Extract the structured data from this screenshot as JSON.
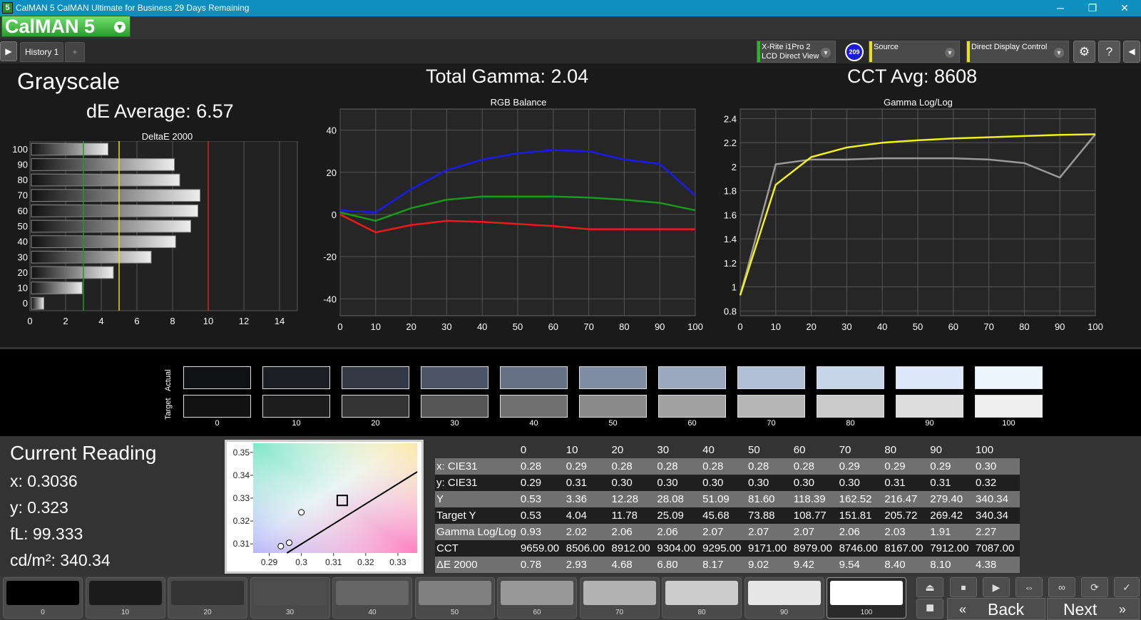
{
  "titlebar": {
    "icon": "5",
    "title": "CalMAN 5 CalMAN Ultimate for Business 29 Days Remaining",
    "minimize": "─",
    "restore": "❐",
    "close": "✕"
  },
  "logo": {
    "text": "CalMAN 5"
  },
  "tabs": {
    "history": "History 1",
    "add": "+"
  },
  "hardware": {
    "meter_line1": "X-Rite i1Pro 2",
    "meter_line2": "LCD Direct View",
    "meter_color": "#22bb22",
    "badge": "209",
    "source": "Source",
    "source_color": "#e8e020",
    "display": "Direct Display Control",
    "display_color": "#e8e020"
  },
  "headings": {
    "section": "Grayscale",
    "de_average": "dE Average: 6.57",
    "total_gamma": "Total Gamma: 2.04",
    "cct_avg": "CCT Avg: 8608"
  },
  "chart_data": [
    {
      "type": "bar",
      "title": "DeltaE 2000",
      "orientation": "horizontal",
      "categories": [
        "100",
        "90",
        "80",
        "70",
        "60",
        "50",
        "40",
        "30",
        "20",
        "10",
        "0"
      ],
      "values": [
        4.38,
        8.1,
        8.4,
        9.54,
        9.42,
        9.02,
        8.17,
        6.8,
        4.68,
        2.93,
        0.78
      ],
      "xlim": [
        0,
        15
      ],
      "xticks": [
        0,
        2,
        4,
        6,
        8,
        10,
        12,
        14
      ],
      "threshold_lines": [
        {
          "x": 3,
          "color": "#1aa01a"
        },
        {
          "x": 5,
          "color": "#e0e020"
        },
        {
          "x": 10,
          "color": "#e02020"
        }
      ]
    },
    {
      "type": "line",
      "title": "RGB Balance",
      "x": [
        0,
        10,
        20,
        30,
        40,
        50,
        60,
        70,
        80,
        90,
        100
      ],
      "series": [
        {
          "color": "#1a1aee",
          "values": [
            2,
            1,
            12,
            21,
            26,
            29,
            30.5,
            30,
            26,
            24,
            9
          ]
        },
        {
          "color": "#1a9a1a",
          "values": [
            1,
            -3,
            3,
            7,
            8.5,
            8.5,
            8.5,
            8,
            7,
            5.5,
            2
          ]
        },
        {
          "color": "#ee1a1a",
          "values": [
            0,
            -8.5,
            -5,
            -3,
            -3.5,
            -4.5,
            -5.5,
            -7,
            -7,
            -7,
            -7
          ]
        }
      ],
      "ylim": [
        -48,
        50
      ],
      "yticks": [
        40,
        20,
        0,
        -20,
        -40
      ],
      "xticks": [
        0,
        10,
        20,
        30,
        40,
        50,
        60,
        70,
        80,
        90,
        100
      ]
    },
    {
      "type": "line",
      "title": "Gamma Log/Log",
      "x": [
        0,
        10,
        20,
        30,
        40,
        50,
        60,
        70,
        80,
        90,
        100
      ],
      "series": [
        {
          "color": "#9a9a9a",
          "values": [
            0.93,
            2.02,
            2.06,
            2.06,
            2.07,
            2.07,
            2.07,
            2.06,
            2.03,
            1.91,
            2.27
          ]
        },
        {
          "color": "#f0f020",
          "values": [
            0.93,
            1.85,
            2.08,
            2.16,
            2.2,
            2.22,
            2.235,
            2.245,
            2.255,
            2.265,
            2.27
          ]
        }
      ],
      "ylim": [
        0.76,
        2.48
      ],
      "yticks": [
        2.4,
        2.2,
        2,
        1.8,
        1.6,
        1.4,
        1.2,
        1,
        0.8
      ],
      "xticks": [
        0,
        10,
        20,
        30,
        40,
        50,
        60,
        70,
        80,
        90,
        100
      ]
    },
    {
      "type": "scatter",
      "title": "CIE",
      "xlim": [
        0.285,
        0.336
      ],
      "ylim": [
        0.306,
        0.354
      ],
      "xticks": [
        0.29,
        0.3,
        0.31,
        0.32,
        0.33
      ],
      "yticks": [
        0.35,
        0.34,
        0.33,
        0.32,
        0.31
      ],
      "points": [
        [
          0.2936,
          0.309
        ],
        [
          0.2962,
          0.3105
        ],
        [
          0.3,
          0.3238
        ]
      ],
      "target": [
        0.3127,
        0.329
      ]
    }
  ],
  "swatches": {
    "row_labels": {
      "actual": "Actual",
      "target": "Target"
    },
    "labels": [
      "0",
      "10",
      "20",
      "30",
      "40",
      "50",
      "60",
      "70",
      "80",
      "90",
      "100"
    ],
    "actual": [
      "#101114",
      "#1b1f25",
      "#323944",
      "#4c5566",
      "#667185",
      "#808da4",
      "#9aa8c0",
      "#b0bfd6",
      "#c6d5ea",
      "#dde9fb",
      "#edf5fe"
    ],
    "target": [
      "#121212",
      "#1d1d1d",
      "#333333",
      "#555555",
      "#707070",
      "#8a8a8a",
      "#a1a1a1",
      "#b6b6b6",
      "#cacaca",
      "#dcdcdc",
      "#efefef"
    ]
  },
  "current_reading": {
    "title": "Current Reading",
    "x": "x: 0.3036",
    "y": "y: 0.323",
    "fl": "fL: 99.333",
    "cdm2": "cd/m²: 340.34"
  },
  "table": {
    "header": [
      "",
      "0",
      "10",
      "20",
      "30",
      "40",
      "50",
      "60",
      "70",
      "80",
      "90",
      "100"
    ],
    "rows": [
      {
        "label": "x: CIE31",
        "values": [
          "0.28",
          "0.29",
          "0.28",
          "0.28",
          "0.28",
          "0.28",
          "0.28",
          "0.29",
          "0.29",
          "0.29",
          "0.30"
        ]
      },
      {
        "label": "y: CIE31",
        "values": [
          "0.29",
          "0.31",
          "0.30",
          "0.30",
          "0.30",
          "0.30",
          "0.30",
          "0.30",
          "0.31",
          "0.31",
          "0.32"
        ]
      },
      {
        "label": "Y",
        "values": [
          "0.53",
          "3.36",
          "12.28",
          "28.08",
          "51.09",
          "81.60",
          "118.39",
          "162.52",
          "216.47",
          "279.40",
          "340.34"
        ]
      },
      {
        "label": "Target Y",
        "values": [
          "0.53",
          "4.04",
          "11.78",
          "25.09",
          "45.68",
          "73.88",
          "108.77",
          "151.81",
          "205.72",
          "269.42",
          "340.34"
        ]
      },
      {
        "label": "Gamma Log/Log",
        "values": [
          "0.93",
          "2.02",
          "2.06",
          "2.06",
          "2.07",
          "2.07",
          "2.07",
          "2.06",
          "2.03",
          "1.91",
          "2.27"
        ]
      },
      {
        "label": "CCT",
        "values": [
          "9659.00",
          "8506.00",
          "8912.00",
          "9304.00",
          "9295.00",
          "9171.00",
          "8979.00",
          "8746.00",
          "8167.00",
          "7912.00",
          "7087.00"
        ]
      },
      {
        "label": "ΔE 2000",
        "values": [
          "0.78",
          "2.93",
          "4.68",
          "6.80",
          "8.17",
          "9.02",
          "9.42",
          "9.54",
          "8.40",
          "8.10",
          "4.38"
        ]
      }
    ]
  },
  "footer": {
    "swatch_labels": [
      "0",
      "10",
      "20",
      "30",
      "40",
      "50",
      "60",
      "70",
      "80",
      "90",
      "100"
    ],
    "swatch_colors": [
      "#000000",
      "#1c1c1c",
      "#333333",
      "#4d4d4d",
      "#666666",
      "#808080",
      "#999999",
      "#b3b3b3",
      "#cccccc",
      "#e6e6e6",
      "#ffffff"
    ],
    "back": "Back",
    "next": "Next",
    "back_arrows": "«",
    "next_arrows": "»"
  }
}
